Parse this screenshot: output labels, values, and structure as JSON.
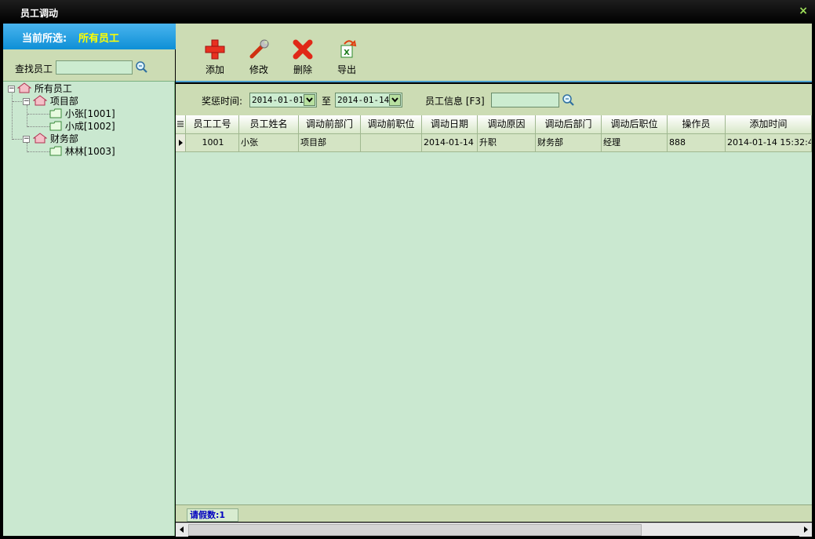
{
  "window": {
    "title": "员工调动",
    "close_glyph": "×"
  },
  "left": {
    "current_label": "当前所选:",
    "current_value": "所有员工",
    "search_label": "查找员工",
    "tree": {
      "root": "所有员工",
      "depts": [
        {
          "name": "项目部",
          "members": [
            "小张[1001]",
            "小成[1002]"
          ]
        },
        {
          "name": "财务部",
          "members": [
            "林林[1003]"
          ]
        }
      ]
    }
  },
  "toolbar": {
    "add_label": "添加",
    "edit_label": "修改",
    "delete_label": "删除",
    "export_label": "导出"
  },
  "filter": {
    "time_label": "奖惩时间:",
    "date_from": "2014-01-01",
    "to_label": "至",
    "date_to": "2014-01-14",
    "info_label": "员工信息 [F3]"
  },
  "grid": {
    "columns": [
      "员工工号",
      "员工姓名",
      "调动前部门",
      "调动前职位",
      "调动日期",
      "调动原因",
      "调动后部门",
      "调动后职位",
      "操作员",
      "添加时间"
    ],
    "rows": [
      [
        "1001",
        "小张",
        "项目部",
        "",
        "2014-01-14",
        "升职",
        "财务部",
        "经理",
        "888",
        "2014-01-14 15:32:4"
      ]
    ]
  },
  "status": {
    "text": "请假数:1"
  },
  "colors": {
    "accent": "#0e8fd6",
    "highlight": "#ffff00",
    "panel": "#ccdcb4",
    "grid": "#cae8d0"
  }
}
